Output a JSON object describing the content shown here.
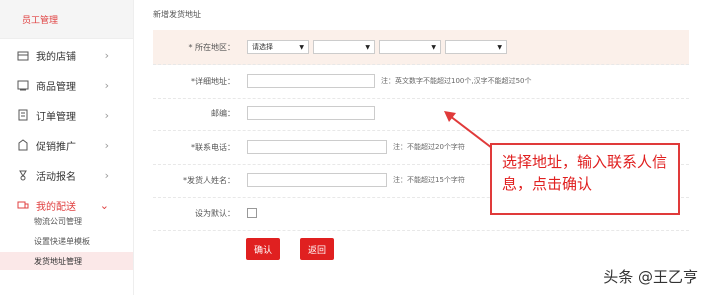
{
  "sidebar": {
    "top_label": "员工管理",
    "items": [
      {
        "label": "我的店铺",
        "icon": "store-icon"
      },
      {
        "label": "商品管理",
        "icon": "goods-icon"
      },
      {
        "label": "订单管理",
        "icon": "order-icon"
      },
      {
        "label": "促销推广",
        "icon": "promotion-icon"
      },
      {
        "label": "活动报名",
        "icon": "activity-icon"
      },
      {
        "label": "我的配送",
        "icon": "delivery-icon"
      }
    ],
    "sub_items": [
      {
        "label": "物流公司管理"
      },
      {
        "label": "设置快递单模板"
      },
      {
        "label": "发货地址管理"
      }
    ],
    "accent": "#e04040"
  },
  "form": {
    "title": "新增发货地址",
    "region": {
      "label": "* 所在地区：",
      "selects": [
        "请选择",
        "",
        "",
        ""
      ]
    },
    "address": {
      "label": "*详细地址：",
      "note": "注：英文数字不能超过100个,汉字不能超过50个"
    },
    "zipcode": {
      "label": "邮编："
    },
    "phone": {
      "label": "*联系电话：",
      "note": "注：不能超过20个字符"
    },
    "sender": {
      "label": "*发货人姓名：",
      "note": "注：不能超过15个字符"
    },
    "default": {
      "label": "设为默认："
    },
    "confirm_label": "确认",
    "back_label": "返回"
  },
  "callout": {
    "text": "选择地址，输入联系人信息，点击确认",
    "color": "#e02020"
  },
  "watermark": "头条 @王乙亨"
}
